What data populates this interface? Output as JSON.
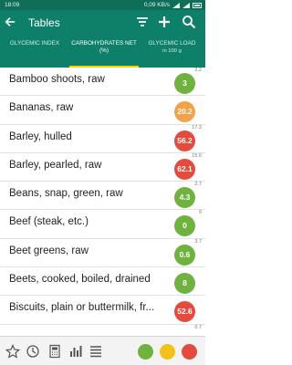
{
  "status": {
    "time": "18:09",
    "speed": "0,09 KB/s"
  },
  "appbar": {
    "title": "Tables"
  },
  "tabs": [
    {
      "label": "GLYCEMIC INDEX",
      "sub": ""
    },
    {
      "label": "CARBOHYDRATES NET (%)",
      "sub": ""
    },
    {
      "label": "GLYCEMIC LOAD",
      "sub": "in 100 g"
    }
  ],
  "colors": {
    "accent": "#0e806a",
    "indicator": "#f1d400",
    "green": "#6fb23f",
    "orange": "#f2a349",
    "red": "#e24b3e"
  },
  "rows": [
    {
      "name": "Bamboo shoots, raw",
      "gl": "3",
      "gi": "2.2",
      "color": "#6fb23f"
    },
    {
      "name": "Bananas, raw",
      "gl": "20.2",
      "gi": "",
      "color": "#f2a349"
    },
    {
      "name": "Barley, hulled",
      "gl": "56.2",
      "gi": "17.3",
      "color": "#e24b3e"
    },
    {
      "name": "Barley, pearled, raw",
      "gl": "62.1",
      "gi": "15.6",
      "color": "#e24b3e"
    },
    {
      "name": "Beans, snap, green, raw",
      "gl": "4.3",
      "gi": "2.7",
      "color": "#6fb23f"
    },
    {
      "name": "Beef (steak, etc.)",
      "gl": "0",
      "gi": "0",
      "color": "#6fb23f"
    },
    {
      "name": "Beet greens, raw",
      "gl": "0.6",
      "gi": "3.7",
      "color": "#6fb23f"
    },
    {
      "name": "Beets, cooked, boiled, drained",
      "gl": "8",
      "gi": "",
      "color": "#6fb23f"
    },
    {
      "name": "Biscuits, plain or buttermilk, fr...",
      "gl": "52.6",
      "gi": "",
      "color": "#e24b3e"
    },
    {
      "name": "",
      "gl": "",
      "gi": "0.7",
      "color": "#e24b3e"
    }
  ],
  "bottom": {
    "icons": [
      "star-icon",
      "history-icon",
      "calculator-icon",
      "bar-chart-icon",
      "list-icon"
    ],
    "dots": [
      "#6fb23f",
      "#f2c21a",
      "#e24b3e"
    ]
  }
}
